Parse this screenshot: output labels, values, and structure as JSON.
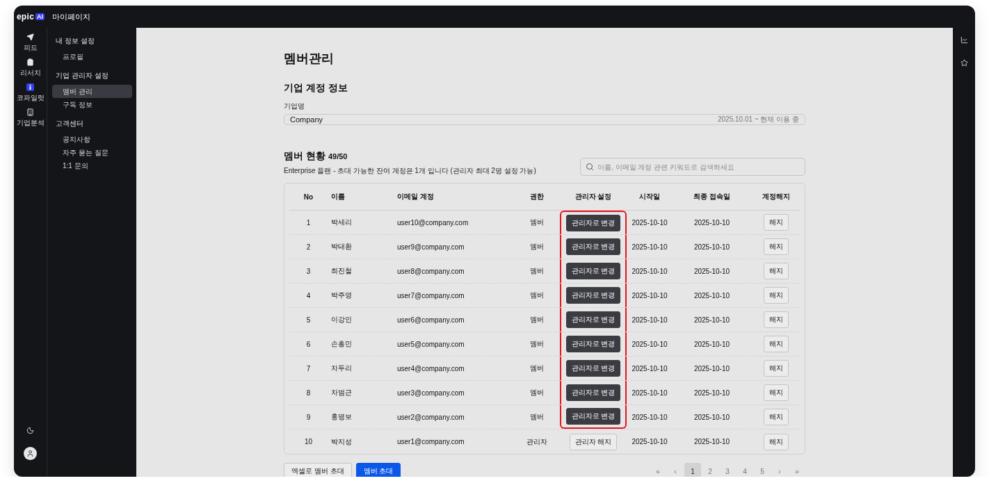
{
  "logo": {
    "text": "epic",
    "badge": "AI"
  },
  "window": {
    "title": "마이페이지"
  },
  "rail": [
    {
      "kind": "send",
      "label": "피드"
    },
    {
      "kind": "clipboard",
      "label": "리서치"
    },
    {
      "kind": "copilot",
      "label": "코파일럿"
    },
    {
      "kind": "building",
      "label": "기업분석"
    }
  ],
  "sidebar": [
    {
      "heading": "내 정보 설정",
      "items": [
        {
          "label": "프로필",
          "selected": false
        }
      ]
    },
    {
      "heading": "기업 관리자 설정",
      "items": [
        {
          "label": "멤버 관리",
          "selected": true
        },
        {
          "label": "구독 정보",
          "selected": false
        }
      ]
    },
    {
      "heading": "고객센터",
      "items": [
        {
          "label": "공지사항",
          "selected": false
        },
        {
          "label": "자주 묻는 질문",
          "selected": false
        },
        {
          "label": "1:1 문의",
          "selected": false
        }
      ]
    }
  ],
  "page_title": "멤버관리",
  "company": {
    "title": "기업 계정 정보",
    "label": "기업명",
    "value": "Company",
    "period": "2025.10.01 ~ 현재 이용 중"
  },
  "members": {
    "title": "멤버 현황",
    "count": "49/50",
    "note": "Enterprise 플랜 - 초대 가능한 잔여 계정은 1개 입니다 (관리자 최대 2명 설정 가능)",
    "search": {
      "placeholder": "이름, 이메일 계정 관련 키워드로 검색하세요"
    }
  },
  "table": {
    "columns": [
      "No",
      "이름",
      "이메일 계정",
      "권한",
      "관리자 설정",
      "시작일",
      "최종 접속일",
      "계정해지"
    ],
    "rows": [
      {
        "no": "1",
        "name": "박세리",
        "email": "user10@company.com",
        "role": "멤버",
        "kind": "promote",
        "action": "관리자로 변경",
        "start": "2025-10-10",
        "last": "2025-10-10",
        "cancel": "해지",
        "highlighted": true
      },
      {
        "no": "2",
        "name": "박태환",
        "email": "user9@company.com",
        "role": "멤버",
        "kind": "promote",
        "action": "관리자로 변경",
        "start": "2025-10-10",
        "last": "2025-10-10",
        "cancel": "해지",
        "highlighted": true
      },
      {
        "no": "3",
        "name": "최진철",
        "email": "user8@company.com",
        "role": "멤버",
        "kind": "promote",
        "action": "관리자로 변경",
        "start": "2025-10-10",
        "last": "2025-10-10",
        "cancel": "해지",
        "highlighted": true
      },
      {
        "no": "4",
        "name": "박주영",
        "email": "user7@company.com",
        "role": "멤버",
        "kind": "promote",
        "action": "관리자로 변경",
        "start": "2025-10-10",
        "last": "2025-10-10",
        "cancel": "해지",
        "highlighted": true
      },
      {
        "no": "5",
        "name": "이강인",
        "email": "user6@company.com",
        "role": "멤버",
        "kind": "promote",
        "action": "관리자로 변경",
        "start": "2025-10-10",
        "last": "2025-10-10",
        "cancel": "해지",
        "highlighted": true
      },
      {
        "no": "6",
        "name": "손흥민",
        "email": "user5@company.com",
        "role": "멤버",
        "kind": "promote",
        "action": "관리자로 변경",
        "start": "2025-10-10",
        "last": "2025-10-10",
        "cancel": "해지",
        "highlighted": true
      },
      {
        "no": "7",
        "name": "차두리",
        "email": "user4@company.com",
        "role": "멤버",
        "kind": "promote",
        "action": "관리자로 변경",
        "start": "2025-10-10",
        "last": "2025-10-10",
        "cancel": "해지",
        "highlighted": true
      },
      {
        "no": "8",
        "name": "차범근",
        "email": "user3@company.com",
        "role": "멤버",
        "kind": "promote",
        "action": "관리자로 변경",
        "start": "2025-10-10",
        "last": "2025-10-10",
        "cancel": "해지",
        "highlighted": true
      },
      {
        "no": "9",
        "name": "홍명보",
        "email": "user2@company.com",
        "role": "멤버",
        "kind": "promote",
        "action": "관리자로 변경",
        "start": "2025-10-10",
        "last": "2025-10-10",
        "cancel": "해지",
        "highlighted": true
      },
      {
        "no": "10",
        "name": "박지성",
        "email": "user1@company.com",
        "role": "관리자",
        "kind": "revoke",
        "action": "관리자 해지",
        "start": "2025-10-10",
        "last": "2025-10-10",
        "cancel": "해지",
        "highlighted": false
      }
    ]
  },
  "actions": [
    "엑셀로 멤버 초대",
    "멤버 초대"
  ],
  "pagination": {
    "first": "«",
    "prev": "‹",
    "pages": [
      {
        "label": "1",
        "selected": true
      },
      {
        "label": "2",
        "selected": false
      },
      {
        "label": "3",
        "selected": false
      },
      {
        "label": "4",
        "selected": false
      },
      {
        "label": "5",
        "selected": false
      }
    ],
    "next": "›",
    "last": "»"
  },
  "right_rail": [
    {
      "kind": "chart"
    },
    {
      "kind": "star"
    }
  ]
}
